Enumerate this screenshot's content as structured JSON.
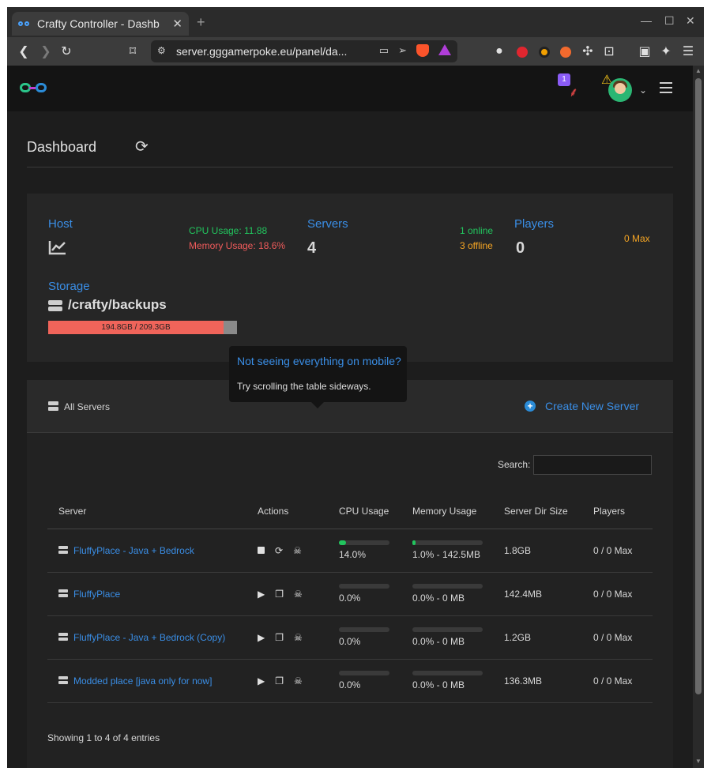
{
  "browser": {
    "tab_title": "Crafty Controller - Dashb",
    "url": "server.gggamerpoke.eu/panel/da..."
  },
  "dashboard": {
    "title": "Dashboard"
  },
  "host": {
    "label": "Host",
    "cpu": "CPU Usage: 11.88",
    "memory": "Memory Usage: 18.6%"
  },
  "servers": {
    "label": "Servers",
    "count": "4",
    "online": "1 online",
    "offline": "3 offline"
  },
  "players": {
    "label": "Players",
    "count": "0",
    "max": "0 Max"
  },
  "storage": {
    "label": "Storage",
    "path": "/crafty/backups",
    "usage_text": "194.8GB / 209.3GB",
    "used_fraction": 0.93
  },
  "notifications": {
    "badge": "1"
  },
  "tooltip": {
    "title": "Not seeing everything on mobile?",
    "body": "Try scrolling the table sideways."
  },
  "all_servers": {
    "title": "All Servers",
    "create_label": "Create New Server",
    "search_label": "Search:",
    "search_value": "",
    "columns": [
      "Server",
      "Actions",
      "CPU Usage",
      "Memory Usage",
      "Server Dir Size",
      "Players"
    ],
    "rows": [
      {
        "name": "FluffyPlace - Java + Bedrock",
        "running": true,
        "cpu": "14.0%",
        "cpu_fraction": 0.14,
        "memory": "1.0% - 142.5MB",
        "mem_fraction": 0.01,
        "size": "1.8GB",
        "players": "0 / 0 Max"
      },
      {
        "name": "FluffyPlace",
        "running": false,
        "cpu": "0.0%",
        "cpu_fraction": 0,
        "memory": "0.0% - 0 MB",
        "mem_fraction": 0,
        "size": "142.4MB",
        "players": "0 / 0 Max"
      },
      {
        "name": "FluffyPlace - Java + Bedrock (Copy)",
        "running": false,
        "cpu": "0.0%",
        "cpu_fraction": 0,
        "memory": "0.0% - 0 MB",
        "mem_fraction": 0,
        "size": "1.2GB",
        "players": "0 / 0 Max"
      },
      {
        "name": "Modded place [java only for now]",
        "running": false,
        "cpu": "0.0%",
        "cpu_fraction": 0,
        "memory": "0.0% - 0 MB",
        "mem_fraction": 0,
        "size": "136.3MB",
        "players": "0 / 0 Max"
      }
    ],
    "footer": "Showing 1 to 4 of 4 entries"
  },
  "colors": {
    "accent": "#3a8ee6",
    "online": "#22c55e",
    "offline": "#f5a524",
    "memory": "#f05b5b"
  }
}
